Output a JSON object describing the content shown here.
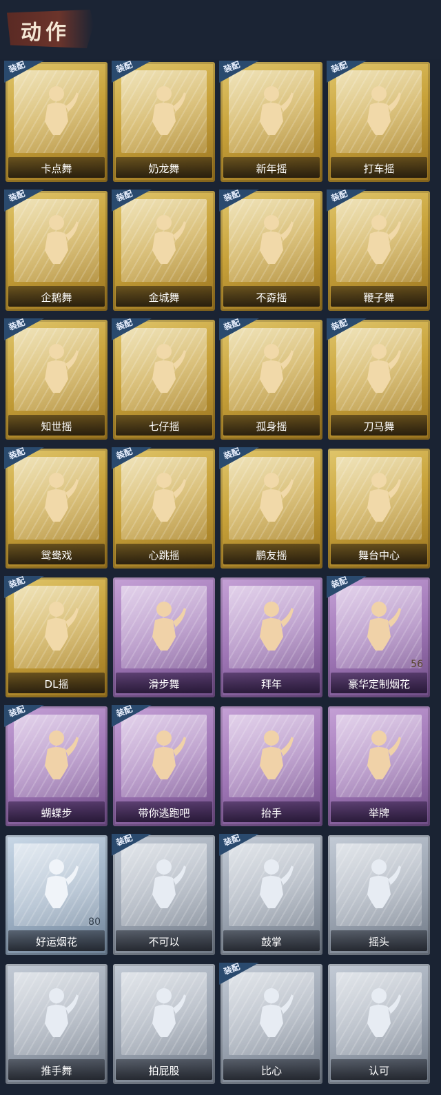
{
  "header": {
    "title": "动作"
  },
  "equip_label": "装配",
  "cards": [
    {
      "label": "卡点舞",
      "rarity": "gold",
      "equipped": true,
      "icon": "dance-pose-icon"
    },
    {
      "label": "奶龙舞",
      "rarity": "gold",
      "equipped": true,
      "icon": "smiley-dance-icon"
    },
    {
      "label": "新年摇",
      "rarity": "gold",
      "equipped": true,
      "icon": "dance-pose-icon"
    },
    {
      "label": "打车摇",
      "rarity": "gold",
      "equipped": true,
      "icon": "dance-pose-icon"
    },
    {
      "label": "企鹅舞",
      "rarity": "gold",
      "equipped": true,
      "icon": "dance-pose-icon"
    },
    {
      "label": "金城舞",
      "rarity": "gold",
      "equipped": true,
      "icon": "dance-pose-icon"
    },
    {
      "label": "不孬摇",
      "rarity": "gold",
      "equipped": true,
      "icon": "dance-pose-icon"
    },
    {
      "label": "鞭子舞",
      "rarity": "gold",
      "equipped": true,
      "icon": "dance-pose-icon"
    },
    {
      "label": "知世摇",
      "rarity": "gold",
      "equipped": true,
      "icon": "dance-pose-icon"
    },
    {
      "label": "七仔摇",
      "rarity": "gold",
      "equipped": true,
      "icon": "dance-pose-icon"
    },
    {
      "label": "孤身摇",
      "rarity": "gold",
      "equipped": true,
      "icon": "dance-pose-icon"
    },
    {
      "label": "刀马舞",
      "rarity": "gold",
      "equipped": true,
      "icon": "dance-pose-icon"
    },
    {
      "label": "鸳鸯戏",
      "rarity": "gold",
      "equipped": true,
      "icon": "dance-pose-icon"
    },
    {
      "label": "心跳摇",
      "rarity": "gold",
      "equipped": true,
      "icon": "dance-pose-icon"
    },
    {
      "label": "鹏友摇",
      "rarity": "gold",
      "equipped": true,
      "icon": "dance-pose-icon"
    },
    {
      "label": "舞台中心",
      "rarity": "gold",
      "equipped": false,
      "icon": "dance-pose-icon"
    },
    {
      "label": "DL摇",
      "rarity": "gold",
      "equipped": true,
      "icon": "dance-pose-icon"
    },
    {
      "label": "滑步舞",
      "rarity": "purple",
      "equipped": false,
      "icon": "dance-pose-icon"
    },
    {
      "label": "拜年",
      "rarity": "purple",
      "equipped": false,
      "icon": "bow-pose-icon"
    },
    {
      "label": "豪华定制烟花",
      "rarity": "purple",
      "equipped": true,
      "icon": "fireworks-box-icon",
      "count": "56"
    },
    {
      "label": "蝴蝶步",
      "rarity": "purple",
      "equipped": true,
      "icon": "dance-pose-icon"
    },
    {
      "label": "带你逃跑吧",
      "rarity": "purple",
      "equipped": true,
      "icon": "dance-pose-icon"
    },
    {
      "label": "抬手",
      "rarity": "purple",
      "equipped": false,
      "icon": "raise-hand-icon"
    },
    {
      "label": "举牌",
      "rarity": "purple",
      "equipped": false,
      "icon": "sign-board-icon"
    },
    {
      "label": "好运烟花",
      "rarity": "blue",
      "equipped": false,
      "icon": "firework-can-icon",
      "count": "80"
    },
    {
      "label": "不可以",
      "rarity": "gray",
      "equipped": true,
      "icon": "finger-wag-icon"
    },
    {
      "label": "鼓掌",
      "rarity": "gray",
      "equipped": true,
      "icon": "clap-icon"
    },
    {
      "label": "摇头",
      "rarity": "gray",
      "equipped": false,
      "icon": "shake-head-icon"
    },
    {
      "label": "推手舞",
      "rarity": "gray",
      "equipped": false,
      "icon": "dance-pose-icon"
    },
    {
      "label": "拍屁股",
      "rarity": "gray",
      "equipped": false,
      "icon": "dance-pose-icon"
    },
    {
      "label": "比心",
      "rarity": "gray",
      "equipped": true,
      "icon": "heart-hand-icon"
    },
    {
      "label": "认可",
      "rarity": "gray",
      "equipped": false,
      "icon": "thumbs-up-icon"
    }
  ]
}
